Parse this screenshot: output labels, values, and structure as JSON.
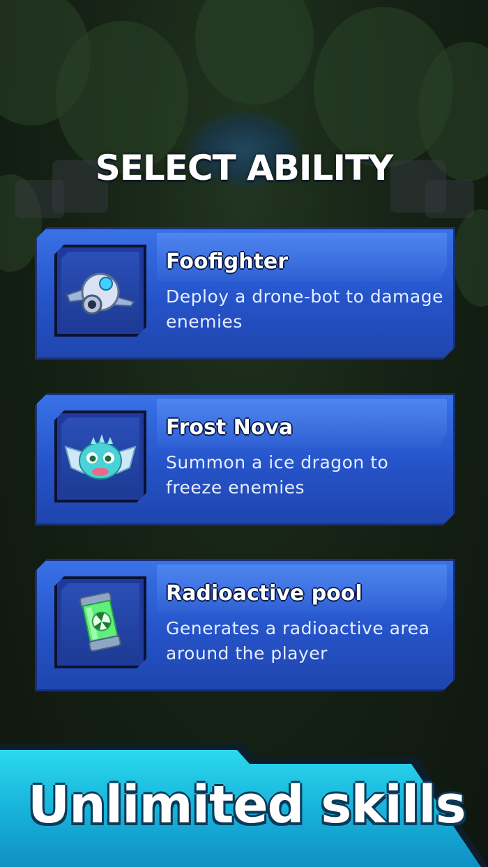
{
  "screen": {
    "title": "SELECT ABILITY",
    "banner_text": "Unlimited skills"
  },
  "abilities": [
    {
      "name": "Foofighter",
      "description": "Deploy a drone-bot to damage enemies",
      "icon": "drone-icon"
    },
    {
      "name": "Frost Nova",
      "description": "Summon a ice dragon to freeze enemies",
      "icon": "ice-dragon-icon"
    },
    {
      "name": "Radioactive pool",
      "description": "Generates a radioactive area around the player",
      "icon": "radioactive-canister-icon"
    }
  ],
  "colors": {
    "card_blue": "#2553c8",
    "card_border": "#0d1a45",
    "banner_cyan": "#2fe0f2",
    "background_green": "#1f311f"
  }
}
